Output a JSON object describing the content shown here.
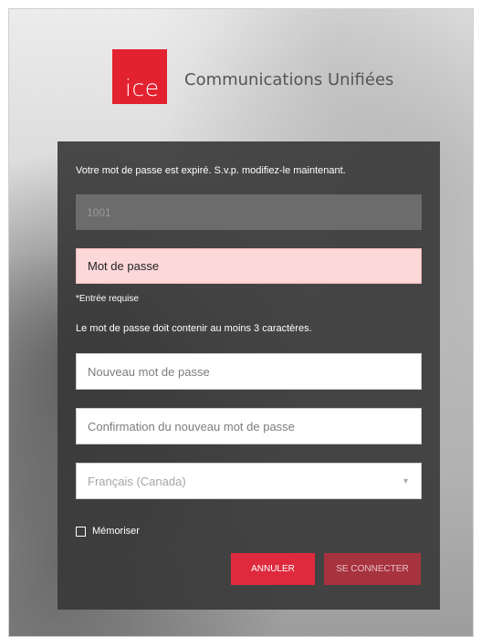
{
  "logo": {
    "mark": "ice",
    "title": "Communications Unifiées",
    "brand_color": "#e3222f"
  },
  "form": {
    "info": "Votre mot de passe est expiré. S.v.p. modifiez-le maintenant.",
    "username_value": "1001",
    "password_placeholder": "Mot de passe",
    "required_message": "*Entrée requise",
    "password_rule": "Le mot de passe doit contenir au moins 3 caractères.",
    "new_password_placeholder": "Nouveau mot de passe",
    "confirm_password_placeholder": "Confirmation du nouveau mot de passe",
    "language_selected": "Français (Canada)",
    "remember_label": "Mémoriser",
    "remember_checked": false
  },
  "buttons": {
    "cancel_label": "ANNULER",
    "connect_label": "SE CONNECTER"
  },
  "icons": {
    "dropdown": "chevron-down-icon",
    "checkbox": "checkbox-icon"
  },
  "colors": {
    "error_bg": "#fdd8d8",
    "cancel_button": "#df2a3e",
    "connect_button": "#a7333f"
  }
}
